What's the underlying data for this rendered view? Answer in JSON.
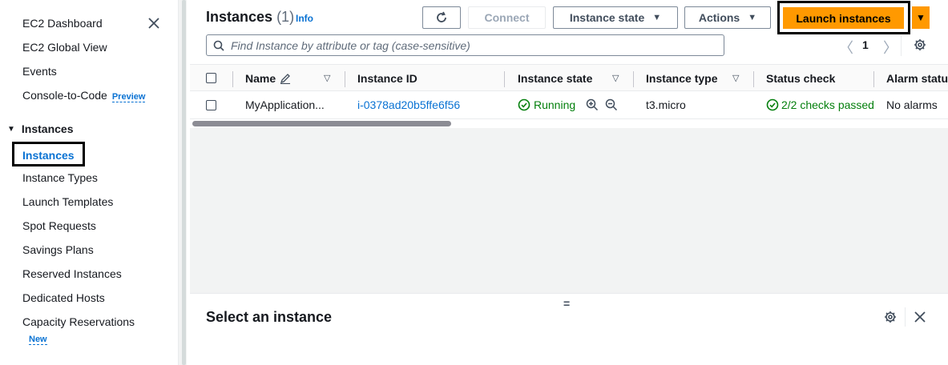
{
  "sidebar": {
    "items": [
      {
        "label": "EC2 Dashboard"
      },
      {
        "label": "EC2 Global View"
      },
      {
        "label": "Events"
      },
      {
        "label": "Console-to-Code",
        "badge": "Preview"
      }
    ],
    "section": "Instances",
    "section_items": [
      {
        "label": "Instances",
        "active": true
      },
      {
        "label": "Instance Types"
      },
      {
        "label": "Launch Templates"
      },
      {
        "label": "Spot Requests"
      },
      {
        "label": "Savings Plans"
      },
      {
        "label": "Reserved Instances"
      },
      {
        "label": "Dedicated Hosts"
      },
      {
        "label": "Capacity Reservations",
        "badge": "New"
      }
    ],
    "close_icon": "close-icon"
  },
  "header": {
    "title": "Instances",
    "count": "(1)",
    "info": "Info",
    "buttons": {
      "refresh_icon": "refresh-icon",
      "connect": "Connect",
      "instance_state": "Instance state",
      "actions": "Actions",
      "launch": "Launch instances"
    }
  },
  "search": {
    "placeholder": "Find Instance by attribute or tag (case-sensitive)"
  },
  "pagination": {
    "page": "1"
  },
  "table": {
    "columns": [
      "Name",
      "Instance ID",
      "Instance state",
      "Instance type",
      "Status check",
      "Alarm status"
    ],
    "rows": [
      {
        "name": "MyApplication...",
        "instance_id": "i-0378ad20b5ffe6f56",
        "state": "Running",
        "type": "t3.micro",
        "status_check": "2/2 checks passed",
        "alarm": "No alarms"
      }
    ]
  },
  "bottom_panel": {
    "title": "Select an instance"
  },
  "colors": {
    "accent": "#ff9900",
    "link": "#0972d3",
    "success": "#037f0c"
  }
}
